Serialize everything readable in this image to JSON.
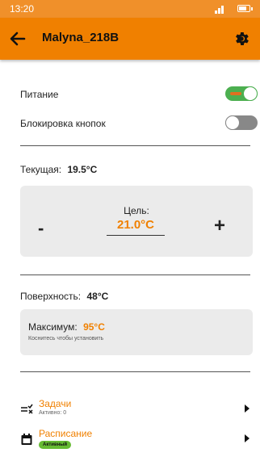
{
  "status_bar": {
    "time": "13:20"
  },
  "app_bar": {
    "title": "Malyna_218B"
  },
  "power": {
    "label": "Питание",
    "on": true
  },
  "lock": {
    "label": "Блокировка кнопок",
    "on": false
  },
  "current": {
    "label": "Текущая:",
    "value": "19.5°C"
  },
  "target": {
    "label": "Цель:",
    "value": "21.0°C",
    "minus": "-",
    "plus": "+"
  },
  "surface": {
    "label": "Поверхность:",
    "value": "48°C"
  },
  "maximum": {
    "label": "Максимум:",
    "value": "95°C",
    "hint": "Коснитесь чтобы установить"
  },
  "menu": {
    "tasks": {
      "label": "Задачи",
      "sub": "Активно: 0"
    },
    "schedule": {
      "label": "Расписание",
      "badge": "Активный"
    }
  },
  "colors": {
    "accent": "#f08000",
    "status_bar": "#f0902a",
    "toggle_on": "#4caf50",
    "badge": "#66bb33"
  }
}
